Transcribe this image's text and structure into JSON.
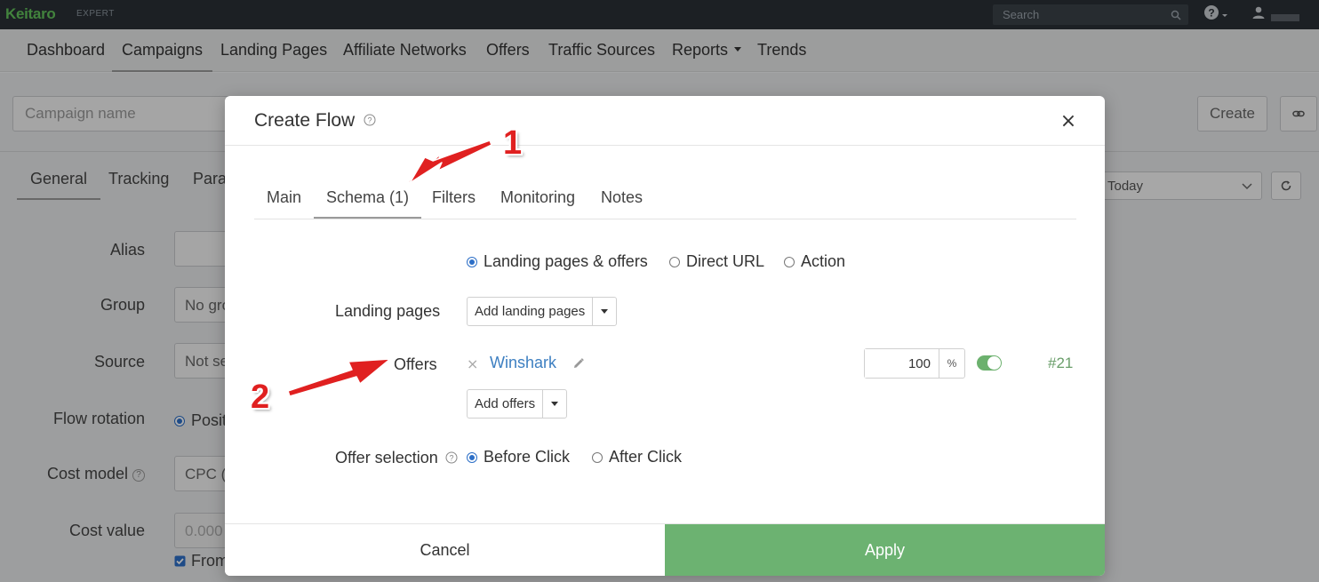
{
  "app": {
    "logo": "Keitaro",
    "edition": "EXPERT",
    "search_placeholder": "Search"
  },
  "nav": {
    "items": [
      "Dashboard",
      "Campaigns",
      "Landing Pages",
      "Affiliate Networks",
      "Offers",
      "Traffic Sources",
      "Reports",
      "Trends"
    ],
    "active": "Campaigns"
  },
  "page": {
    "campaign_placeholder": "Campaign name",
    "create_label": "Create",
    "tabs": [
      "General",
      "Tracking",
      "Para"
    ],
    "date_range": "Today",
    "form": {
      "alias_label": "Alias",
      "group_label": "Group",
      "group_value": "No gro",
      "source_label": "Source",
      "source_value": "Not se",
      "flow_rotation_label": "Flow rotation",
      "flow_rotation_value": "Positi",
      "cost_model_label": "Cost model",
      "cost_model_value": "CPC (",
      "cost_value_label": "Cost value",
      "cost_value_value": "0.000",
      "from_label": "From"
    }
  },
  "modal": {
    "title": "Create Flow",
    "close_glyph": "×",
    "tabs": [
      "Main",
      "Schema (1)",
      "Filters",
      "Monitoring",
      "Notes"
    ],
    "active_tab": "Schema (1)",
    "schema_options": [
      "Landing pages & offers",
      "Direct URL",
      "Action"
    ],
    "schema_selected": "Landing pages & offers",
    "landing_pages_label": "Landing pages",
    "add_landing_pages_label": "Add landing pages",
    "offers_label": "Offers",
    "offer": {
      "remove_glyph": "×",
      "name": "Winshark",
      "weight": "100",
      "weight_unit": "%",
      "enabled": true,
      "id": "#21"
    },
    "add_offers_label": "Add offers",
    "offer_selection_label": "Offer selection",
    "offer_selection_options": [
      "Before Click",
      "After Click"
    ],
    "offer_selection_selected": "Before Click",
    "cancel_label": "Cancel",
    "apply_label": "Apply"
  },
  "annotations": {
    "step1": "1",
    "step2": "2"
  },
  "colors": {
    "brand_green": "#62c25a",
    "apply_green": "#6cb271",
    "link_blue": "#3d7fc1",
    "annotation_red": "#e02020"
  },
  "icons": [
    "search-icon",
    "help-icon",
    "user-icon",
    "link-icon",
    "chevron-down-icon",
    "refresh-icon",
    "close-icon",
    "edit-icon",
    "caret-down-icon",
    "arrow-icon"
  ]
}
